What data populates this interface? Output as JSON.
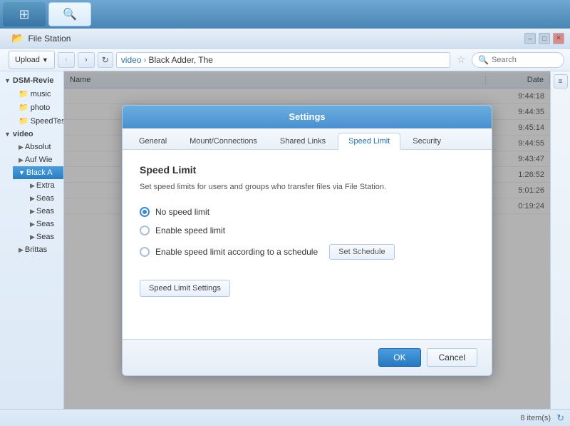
{
  "app": {
    "title": "File Station"
  },
  "taskbar": {
    "apps": [
      {
        "name": "grid-app",
        "icon": "⊞",
        "active": false
      },
      {
        "name": "file-station-app",
        "icon": "🔍",
        "active": true
      }
    ]
  },
  "titlebar": {
    "title": "File Station",
    "buttons": [
      "_",
      "□",
      "✕"
    ]
  },
  "toolbar": {
    "upload_label": "Upload",
    "breadcrumb": {
      "parts": [
        "video",
        "Black Adder, The"
      ]
    },
    "search_placeholder": "Search"
  },
  "sidebar": {
    "groups": [
      {
        "label": "DSM-Revie",
        "expanded": true,
        "children": [
          {
            "label": "music",
            "icon": "📁"
          },
          {
            "label": "photo",
            "icon": "📁"
          },
          {
            "label": "SpeedTest",
            "icon": "📁"
          }
        ]
      },
      {
        "label": "video",
        "expanded": true,
        "children": [
          {
            "label": "Absolut",
            "icon": "📁"
          },
          {
            "label": "Auf Wie",
            "icon": "📁"
          },
          {
            "label": "Black A",
            "icon": "📁",
            "active": true,
            "children": [
              {
                "label": "Extra",
                "icon": "📁"
              },
              {
                "label": "Seas",
                "icon": "📁"
              },
              {
                "label": "Seas",
                "icon": "📁"
              },
              {
                "label": "Seas",
                "icon": "📁"
              },
              {
                "label": "Seas",
                "icon": "📁"
              }
            ]
          },
          {
            "label": "Brittas",
            "icon": "📁"
          }
        ]
      }
    ]
  },
  "file_list": {
    "header": {
      "name": "Name",
      "date": "Date"
    },
    "rows": [
      {
        "name": "...",
        "date": "9:44:18"
      },
      {
        "name": "...",
        "date": "9:44:35"
      },
      {
        "name": "...",
        "date": "9:45:14"
      },
      {
        "name": "...",
        "date": "9:44:55"
      },
      {
        "name": "...",
        "date": "9:43:47"
      },
      {
        "name": "...",
        "date": "1:26:52"
      },
      {
        "name": "...",
        "date": "5:01:26"
      },
      {
        "name": "...",
        "date": "0:19:24"
      }
    ]
  },
  "statusbar": {
    "items_count": "8 item(s)"
  },
  "modal": {
    "title": "Settings",
    "tabs": [
      {
        "label": "General",
        "active": false
      },
      {
        "label": "Mount/Connections",
        "active": false
      },
      {
        "label": "Shared Links",
        "active": false
      },
      {
        "label": "Speed Limit",
        "active": true
      },
      {
        "label": "Security",
        "active": false
      }
    ],
    "speed_limit": {
      "section_title": "Speed Limit",
      "description": "Set speed limits for users and groups who transfer files via File Station.",
      "options": [
        {
          "label": "No speed limit",
          "selected": true
        },
        {
          "label": "Enable speed limit",
          "selected": false
        },
        {
          "label": "Enable speed limit according to a schedule",
          "selected": false
        }
      ],
      "set_schedule_label": "Set Schedule",
      "settings_btn_label": "Speed Limit Settings"
    },
    "footer": {
      "ok_label": "OK",
      "cancel_label": "Cancel"
    }
  }
}
